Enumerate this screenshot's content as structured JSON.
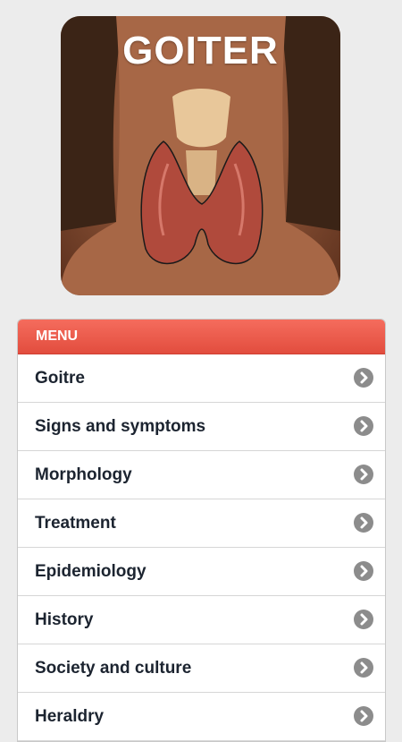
{
  "hero": {
    "title": "GOITER"
  },
  "menu": {
    "header": "MENU",
    "items": [
      {
        "label": "Goitre"
      },
      {
        "label": "Signs and symptoms"
      },
      {
        "label": "Morphology"
      },
      {
        "label": "Treatment"
      },
      {
        "label": "Epidemiology"
      },
      {
        "label": "History"
      },
      {
        "label": "Society and culture"
      },
      {
        "label": "Heraldry"
      }
    ]
  }
}
